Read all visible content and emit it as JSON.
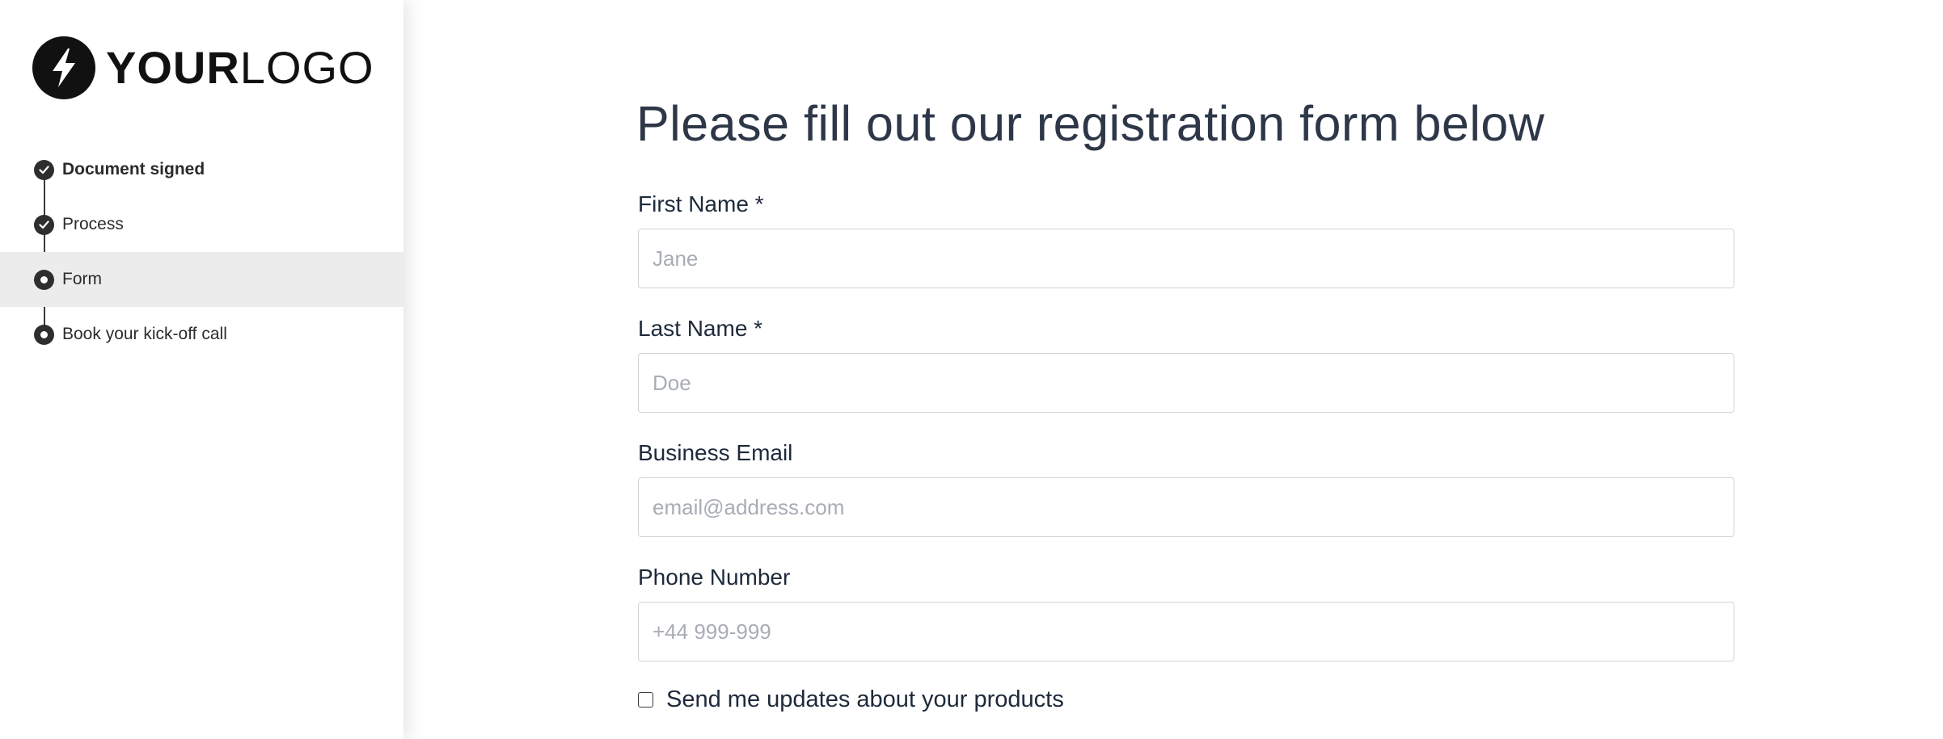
{
  "brand": {
    "logo_bold": "YOUR",
    "logo_light": "LOGO"
  },
  "steps": [
    {
      "label": "Document signed",
      "state": "done"
    },
    {
      "label": "Process",
      "state": "done"
    },
    {
      "label": "Form",
      "state": "current"
    },
    {
      "label": "Book your kick-off call",
      "state": "pending"
    }
  ],
  "form": {
    "title": "Please fill out our registration form below",
    "fields": {
      "first_name": {
        "label": "First Name *",
        "placeholder": "Jane"
      },
      "last_name": {
        "label": "Last Name *",
        "placeholder": "Doe"
      },
      "email": {
        "label": "Business Email",
        "placeholder": "email@address.com"
      },
      "phone": {
        "label": "Phone Number",
        "placeholder": "+44 999-999"
      }
    },
    "updates_checkbox": {
      "label": "Send me updates about your products",
      "checked": false
    }
  },
  "colors": {
    "accent_dark": "#2e2e2e",
    "active_step_bg": "#ececec",
    "input_border": "#cfd4da",
    "placeholder": "#a8adb4"
  },
  "icons": [
    "logo-bolt-icon",
    "check-icon",
    "radio-dot-icon"
  ]
}
